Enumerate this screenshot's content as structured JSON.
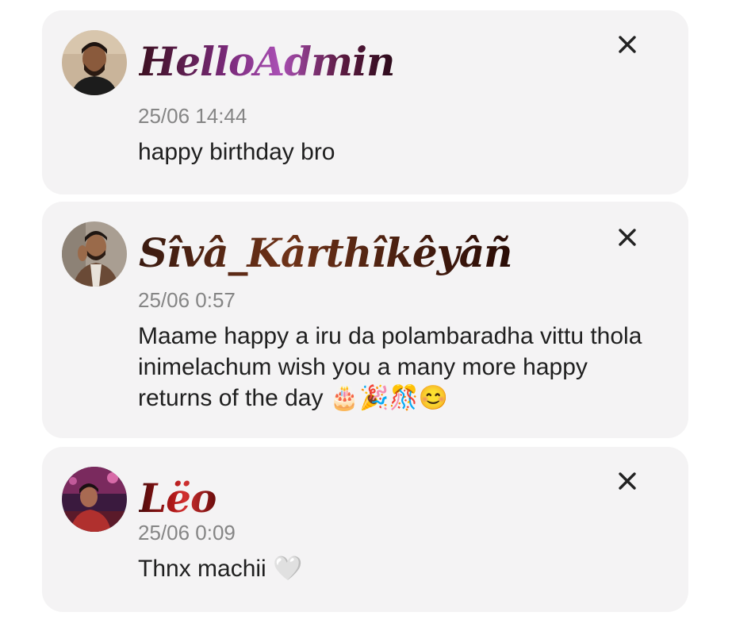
{
  "comments": [
    {
      "username": "HelloAdmin",
      "timestamp": "25/06 14:44",
      "message": "happy birthday bro",
      "avatar_icon": "user-avatar-photo"
    },
    {
      "username": "Sîvâ_Kârthîkêyâñ",
      "timestamp": "25/06 0:57",
      "message": "Maame happy a iru da polambaradha vittu thola inimelachum wish you a many more happy returns of the day 🎂🎉🎊😊",
      "avatar_icon": "user-avatar-photo"
    },
    {
      "username": "Lëo",
      "timestamp": "25/06 0:09",
      "message": "Thnx machii 🤍",
      "avatar_icon": "user-avatar-photo"
    }
  ],
  "close_icon": "close-icon",
  "colors": {
    "card_background": "#f4f3f4",
    "timestamp": "#858585",
    "message_text": "#1f1f1f",
    "close_icon": "#222222"
  }
}
